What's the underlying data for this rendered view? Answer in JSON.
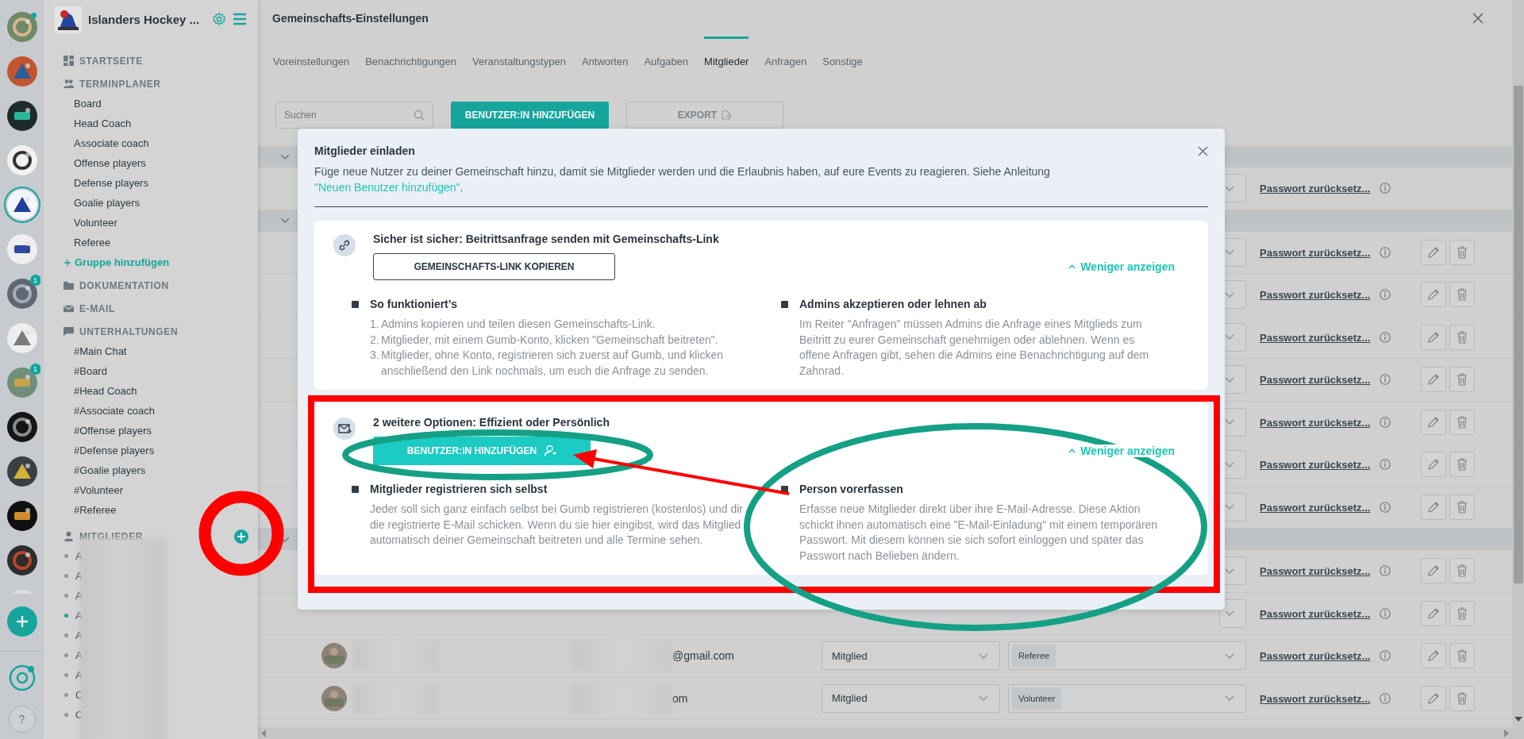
{
  "rail": {
    "items": [
      {
        "selected": false,
        "dot": true
      },
      {
        "selected": false,
        "dot": false
      },
      {
        "selected": false,
        "dot": false
      },
      {
        "selected": false,
        "dot": false
      },
      {
        "selected": true,
        "dot": false
      },
      {
        "selected": false,
        "dot": false
      },
      {
        "selected": false,
        "dot": false,
        "badge": "1"
      },
      {
        "selected": false,
        "dot": false
      },
      {
        "selected": false,
        "dot": false,
        "badge": "1"
      },
      {
        "selected": false,
        "dot": false
      },
      {
        "selected": false,
        "dot": false
      },
      {
        "selected": false,
        "dot": false
      },
      {
        "selected": false,
        "dot": false
      },
      {
        "selected": false,
        "dot": false
      }
    ],
    "help": "?"
  },
  "sidebar": {
    "title": "Islanders Hockey ...",
    "sections": [
      {
        "kind": "home",
        "label": "STARTSEITE"
      },
      {
        "kind": "planner",
        "label": "TERMINPLANER",
        "items": [
          "Board",
          "Head Coach",
          "Associate coach",
          "Offense players",
          "Defense players",
          "Goalie players",
          "Volunteer",
          "Referee"
        ],
        "add_label": "Gruppe hinzufügen"
      },
      {
        "kind": "docs",
        "label": "DOKUMENTATION"
      },
      {
        "kind": "mail",
        "label": "E-MAIL"
      },
      {
        "kind": "chat",
        "label": "UNTERHALTUNGEN",
        "items": [
          "#Main Chat",
          "#Board",
          "#Head Coach",
          "#Associate coach",
          "#Offense players",
          "#Defense players",
          "#Goalie players",
          "#Volunteer",
          "#Referee"
        ]
      },
      {
        "kind": "members",
        "label": "MITGLIEDER",
        "members": [
          {
            "label": "A",
            "online": false
          },
          {
            "label": "A",
            "online": false
          },
          {
            "label": "A",
            "online": false
          },
          {
            "label": "A",
            "online": true
          },
          {
            "label": "A",
            "online": false
          },
          {
            "label": "A",
            "online": false
          },
          {
            "label": "A",
            "online": false
          },
          {
            "label": "C",
            "online": false
          },
          {
            "label": "C",
            "online": false
          }
        ]
      }
    ]
  },
  "page": {
    "title": "Gemeinschafts-Einstellungen",
    "tabs": [
      {
        "label": "Voreinstellungen",
        "selected": false
      },
      {
        "label": "Benachrichtigungen",
        "selected": false
      },
      {
        "label": "Veranstaltungstypen",
        "selected": false
      },
      {
        "label": "Antworten",
        "selected": false
      },
      {
        "label": "Aufgaben",
        "selected": false
      },
      {
        "label": "Mitglieder",
        "selected": true
      },
      {
        "label": "Anfragen",
        "selected": false
      },
      {
        "label": "Sonstige",
        "selected": false
      }
    ],
    "search": {
      "placeholder": "Suchen"
    },
    "add_button": "BENUTZER:IN HINZUFÜGEN",
    "export_button": "EXPORT"
  },
  "table": {
    "sections": [
      {
        "expanded": true,
        "rows": [
          {
            "reset": "Passwort zurücksetz...",
            "actions": false
          }
        ]
      },
      {
        "expanded": true,
        "rows": [
          {
            "reset": "Passwort zurücksetz...",
            "actions": true
          },
          {
            "reset": "Passwort zurücksetz...",
            "actions": true
          },
          {
            "reset": "Passwort zurücksetz...",
            "actions": true
          },
          {
            "reset": "Passwort zurücksetz...",
            "actions": true
          },
          {
            "reset": "Passwort zurücksetz...",
            "actions": true
          },
          {
            "reset": "Passwort zurücksetz...",
            "actions": true
          },
          {
            "reset": "Passwort zurücksetz...",
            "actions": true
          }
        ]
      },
      {
        "expanded": true,
        "rows": [
          {
            "reset": "Passwort zurücksetz...",
            "actions": true
          },
          {
            "reset": "Passwort zurücksetz...",
            "actions": true
          },
          {
            "blurred": true,
            "email": "@gmail.com",
            "role": "Mitglied",
            "group": "Referee",
            "reset": "Passwort zurücksetz...",
            "actions": true
          },
          {
            "blurred": true,
            "email": "om",
            "role": "Mitglied",
            "group": "Volunteer",
            "reset": "Passwort zurücksetz...",
            "actions": true
          }
        ]
      }
    ]
  },
  "modal": {
    "title": "Mitglieder einladen",
    "description": "Füge neue Nutzer zu deiner Gemeinschaft hinzu, damit sie Mitglieder werden und die Erlaubnis haben, auf eure Events zu reagieren. Siehe Anleitung",
    "link": "\"Neuen Benutzer hinzufügen\"",
    "description_end": ".",
    "cards": [
      {
        "kind": "link",
        "heading": "Sicher ist sicher: Beitrittsanfrage senden mit Gemeinschafts-Link",
        "button": "GEMEINSCHAFTS-LINK KOPIEREN",
        "toggle": "Weniger anzeigen",
        "columns": [
          {
            "title": "So funktioniert’s",
            "list": [
              {
                "num": "1.",
                "text": "Admins kopieren und teilen diesen Gemeinschafts-Link."
              },
              {
                "num": "2.",
                "text": "Mitglieder, mit einem Gumb-Konto, klicken \"Gemeinschaft beitreten\"."
              },
              {
                "num": "3.",
                "text": "Mitglieder, ohne Konto, registrieren sich zuerst auf Gumb, und klicken anschließend den Link nochmals, um euch die Anfrage zu senden."
              }
            ]
          },
          {
            "title": "Admins akzeptieren oder lehnen ab",
            "text": "Im Reiter \"Anfragen\" müssen Admins die Anfrage eines Mitglieds zum Beitritt zu eurer Gemeinschaft genehmigen oder ablehnen. Wenn es offene Anfragen gibt, sehen die Admins eine Benachrichtigung auf dem Zahnrad."
          }
        ]
      },
      {
        "kind": "invite",
        "heading": "2 weitere Optionen: Effizient oder Persönlich",
        "button": "BENUTZER:IN HINZUFÜGEN",
        "toggle": "Weniger anzeigen",
        "columns": [
          {
            "title": "Mitglieder registrieren sich selbst",
            "text": "Jeder soll sich ganz einfach selbst bei Gumb registrieren (kostenlos) und dir die registrierte E-Mail schicken. Wenn du sie hier eingibst, wird das Mitglied automatisch deiner Gemeinschaft beitreten und alle Termine sehen."
          },
          {
            "title": "Person vorerfassen",
            "text": "Erfasse neue Mitglieder direkt über ihre E-Mail-Adresse. Diese Aktion schickt ihnen automatisch eine \"E-Mail-Einladung\" mit einem temporären Passwort. Mit diesem können sie sich sofort einloggen und später das Passwort nach Belieben ändern."
          }
        ]
      }
    ]
  }
}
